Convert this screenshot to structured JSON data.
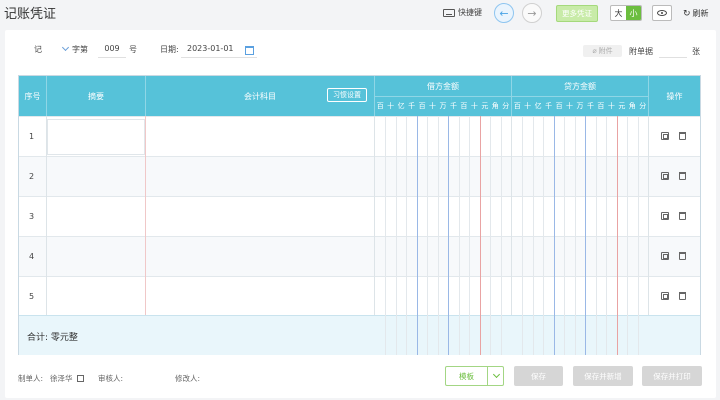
{
  "page": {
    "title": "记账凭证"
  },
  "toolbar": {
    "shortcut_label": "快捷键",
    "more_label": "更多凭证",
    "size_large": "大",
    "size_small": "小",
    "size_selected": "小",
    "refresh_label": "刷新"
  },
  "form": {
    "word_value": "记",
    "word_suffix": "字第",
    "number_value": "009",
    "number_suffix": "号",
    "date_label": "日期:",
    "date_value": "2023-01-01",
    "attachment_label": "附件",
    "attached_docs_label": "附单据",
    "attached_docs_unit": "张"
  },
  "table": {
    "headers": {
      "seq": "序号",
      "summary": "摘要",
      "account": "会计科目",
      "habit_button": "习惯设置",
      "debit": "借方金额",
      "credit": "贷方金额",
      "actions": "操作"
    },
    "digit_units": [
      "百",
      "十",
      "亿",
      "千",
      "百",
      "十",
      "万",
      "千",
      "百",
      "十",
      "元",
      "角",
      "分"
    ],
    "rows": [
      {
        "seq": "1"
      },
      {
        "seq": "2"
      },
      {
        "seq": "3"
      },
      {
        "seq": "4"
      },
      {
        "seq": "5"
      }
    ],
    "total_label": "合计: 零元整"
  },
  "footer": {
    "maker_label": "制单人:",
    "maker_name": "徐泽华",
    "reviewer_label": "审核人:",
    "modifier_label": "修改人:",
    "template_label": "模板",
    "save_label": "保存",
    "save_new_label": "保存并新增",
    "save_print_label": "保存并打印"
  },
  "colors": {
    "header_bg": "#56c2d9",
    "accent_green": "#6cbe3f",
    "yuan_line": "#e9a3a3",
    "wan_line": "#9ab8e6"
  }
}
